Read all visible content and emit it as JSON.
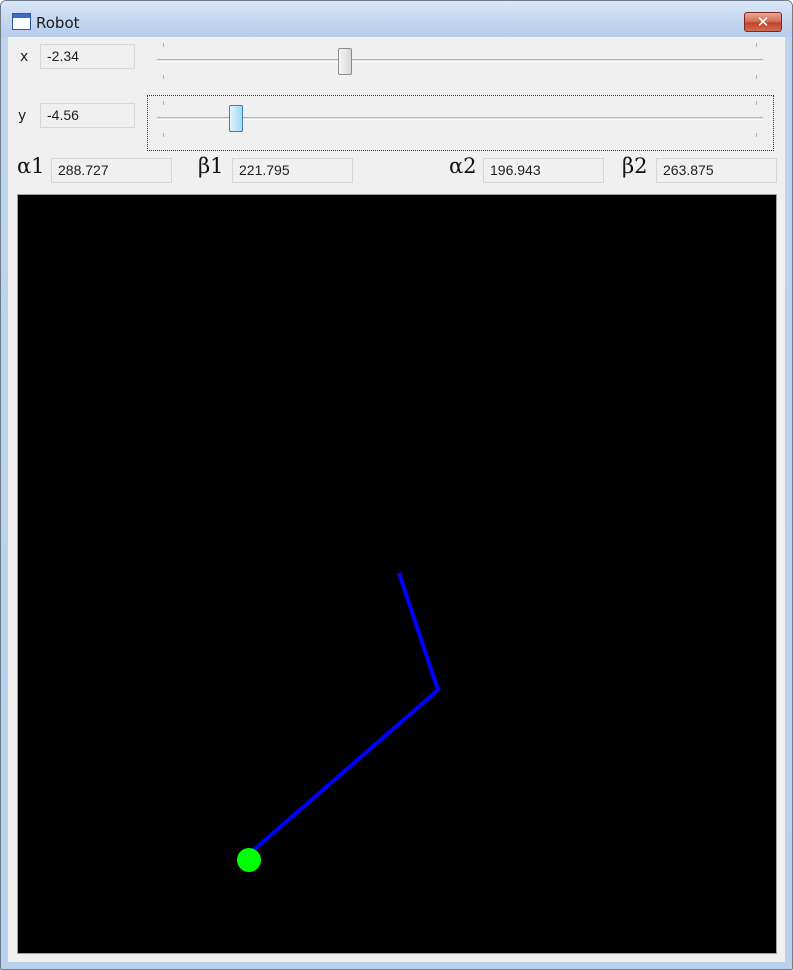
{
  "window": {
    "title": "Robot",
    "close_glyph": "✕"
  },
  "controls": {
    "x": {
      "label": "x",
      "value": "-2.34",
      "slider_fraction": 0.31
    },
    "y": {
      "label": "y",
      "value": "-4.56",
      "slider_fraction": 0.13
    }
  },
  "angles": {
    "alpha1": {
      "label": "α1",
      "value": "288.727"
    },
    "beta1": {
      "label": "β1",
      "value": "221.795"
    },
    "alpha2": {
      "label": "α2",
      "value": "196.943"
    },
    "beta2": {
      "label": "β2",
      "value": "263.875"
    }
  },
  "canvas": {
    "background_color": "#000000",
    "arm_color": "#0000ff",
    "base_color": "#00ff00"
  }
}
